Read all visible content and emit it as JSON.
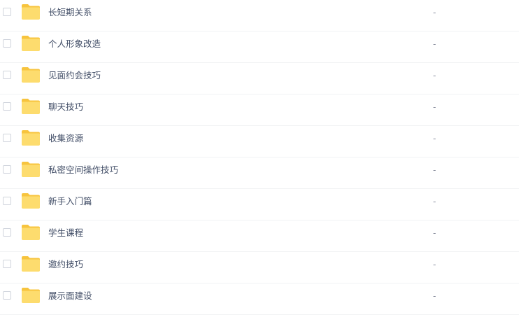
{
  "files": [
    {
      "name": "长短期关系",
      "size": "-",
      "icon": "folder-icon"
    },
    {
      "name": "个人形象改造",
      "size": "-",
      "icon": "folder-icon"
    },
    {
      "name": "见面约会技巧",
      "size": "-",
      "icon": "folder-icon"
    },
    {
      "name": "聊天技巧",
      "size": "-",
      "icon": "folder-icon"
    },
    {
      "name": "收集资源",
      "size": "-",
      "icon": "folder-icon"
    },
    {
      "name": "私密空间操作技巧",
      "size": "-",
      "icon": "folder-icon"
    },
    {
      "name": "新手入门篇",
      "size": "-",
      "icon": "folder-icon"
    },
    {
      "name": "学生课程",
      "size": "-",
      "icon": "folder-icon"
    },
    {
      "name": "邀约技巧",
      "size": "-",
      "icon": "folder-icon"
    },
    {
      "name": "展示面建设",
      "size": "-",
      "icon": "folder-icon"
    }
  ],
  "colors": {
    "folder_back": "#f7c43e",
    "folder_front": "#fddc6e",
    "row_divider": "#f1f2f4",
    "checkbox_border": "#d0d4dc",
    "text": "#424e67",
    "muted_text": "#878c9c"
  }
}
